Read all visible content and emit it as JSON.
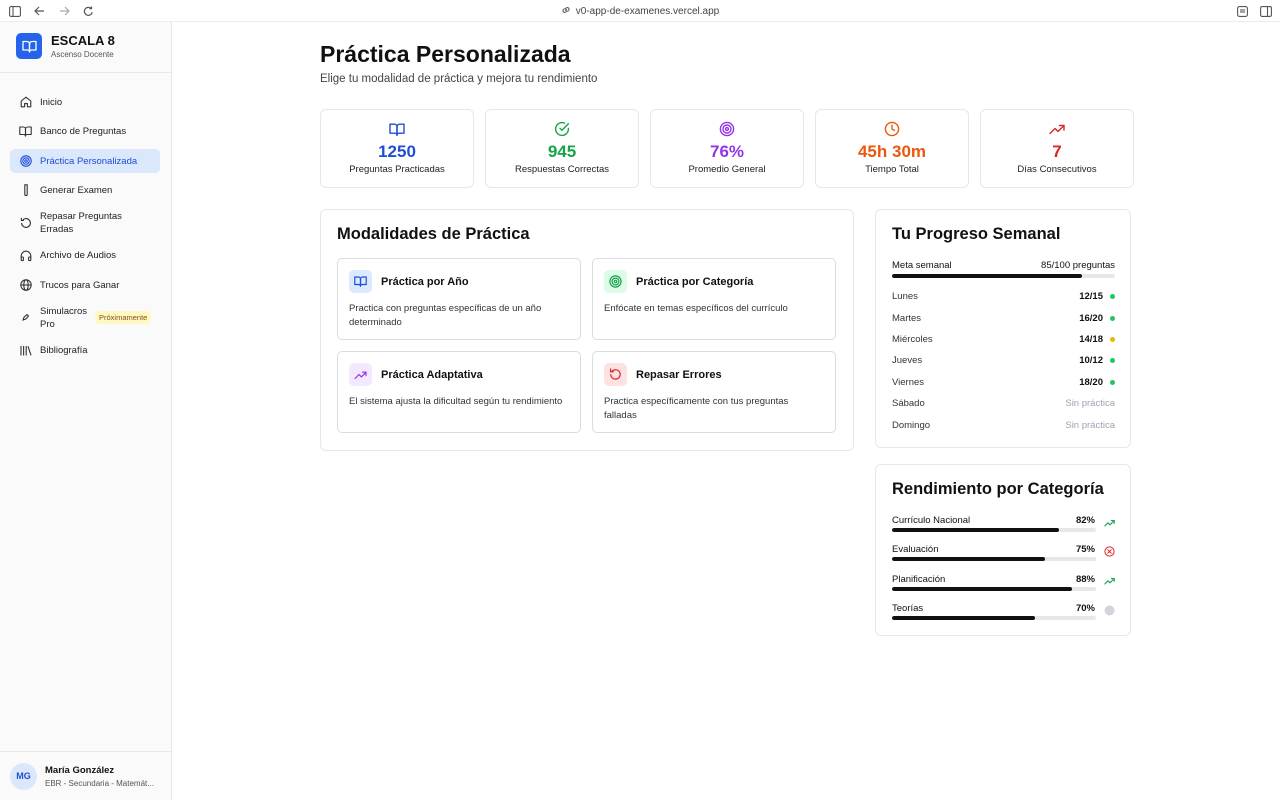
{
  "browser": {
    "url": "v0-app-de-examenes.vercel.app"
  },
  "brand": {
    "title": "ESCALA 8",
    "subtitle": "Ascenso Docente"
  },
  "nav": [
    {
      "label": "Inicio"
    },
    {
      "label": "Banco de Preguntas"
    },
    {
      "label": "Práctica Personalizada"
    },
    {
      "label": "Generar Examen"
    },
    {
      "label": "Repasar Preguntas Erradas"
    },
    {
      "label": "Archivo de Audios"
    },
    {
      "label": "Trucos para Ganar"
    },
    {
      "label": "Simulacros Pro",
      "badge": "Próximamente"
    },
    {
      "label": "Bibliografía"
    }
  ],
  "user": {
    "initials": "MG",
    "name": "María González",
    "subtitle": "EBR - Secundaria - Matemát..."
  },
  "page": {
    "title": "Práctica Personalizada",
    "subtitle": "Elige tu modalidad de práctica y mejora tu rendimiento"
  },
  "stats": [
    {
      "value": "1250",
      "label": "Preguntas Practicadas",
      "color": "#1d4ed8",
      "icon": "book-icon"
    },
    {
      "value": "945",
      "label": "Respuestas Correctas",
      "color": "#16a34a",
      "icon": "check-circle-icon"
    },
    {
      "value": "76%",
      "label": "Promedio General",
      "color": "#9333ea",
      "icon": "target-icon"
    },
    {
      "value": "45h 30m",
      "label": "Tiempo Total",
      "color": "#ea580c",
      "icon": "clock-icon"
    },
    {
      "value": "7",
      "label": "Días Consecutivos",
      "color": "#dc2626",
      "icon": "trending-up-icon"
    }
  ],
  "modalities": {
    "title": "Modalidades de Práctica",
    "items": [
      {
        "title": "Práctica por Año",
        "desc": "Practica con preguntas específicas de un año determinado",
        "icon": "book-icon",
        "bg": "#dbeafe",
        "color": "#1d4ed8"
      },
      {
        "title": "Práctica por Categoría",
        "desc": "Enfócate en temas específicos del currículo",
        "icon": "target-icon",
        "bg": "#dcfce7",
        "color": "#16a34a"
      },
      {
        "title": "Práctica Adaptativa",
        "desc": "El sistema ajusta la dificultad según tu rendimiento",
        "icon": "trending-up-icon",
        "bg": "#f3e8ff",
        "color": "#9333ea"
      },
      {
        "title": "Repasar Errores",
        "desc": "Practica específicamente con tus preguntas falladas",
        "icon": "rotate-ccw-icon",
        "bg": "#fee2e2",
        "color": "#dc2626"
      }
    ]
  },
  "weekly": {
    "title": "Tu Progreso Semanal",
    "goal_label": "Meta semanal",
    "goal_value": "85/100 preguntas",
    "goal_fraction": 0.85,
    "days": [
      {
        "day": "Lunes",
        "value": "12/15",
        "dot": "#22c55e"
      },
      {
        "day": "Martes",
        "value": "16/20",
        "dot": "#22c55e"
      },
      {
        "day": "Miércoles",
        "value": "14/18",
        "dot": "#eab308"
      },
      {
        "day": "Jueves",
        "value": "10/12",
        "dot": "#22c55e"
      },
      {
        "day": "Viernes",
        "value": "18/20",
        "dot": "#22c55e"
      },
      {
        "day": "Sábado",
        "value": "Sin práctica",
        "dot": null
      },
      {
        "day": "Domingo",
        "value": "Sin práctica",
        "dot": null
      }
    ]
  },
  "categories": {
    "title": "Rendimiento por Categoría",
    "items": [
      {
        "name": "Currículo Nacional",
        "pct": "82%",
        "fraction": 0.82,
        "icon": "trending-up-icon",
        "color": "#16a34a"
      },
      {
        "name": "Evaluación",
        "pct": "75%",
        "fraction": 0.75,
        "icon": "x-circle-icon",
        "color": "#dc2626"
      },
      {
        "name": "Planificación",
        "pct": "88%",
        "fraction": 0.88,
        "icon": "trending-up-icon",
        "color": "#16a34a"
      },
      {
        "name": "Teorías",
        "pct": "70%",
        "fraction": 0.7,
        "icon": "circle-icon",
        "color": "#d1d5db"
      }
    ]
  }
}
